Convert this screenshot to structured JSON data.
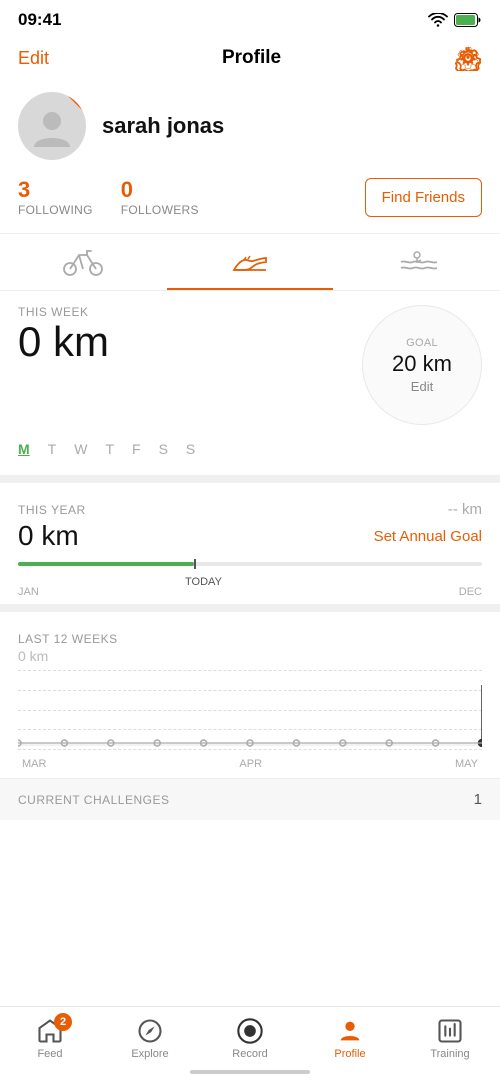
{
  "statusBar": {
    "time": "09:41",
    "showArrow": true
  },
  "navBar": {
    "editLabel": "Edit",
    "title": "Profile"
  },
  "profile": {
    "name": "sarah jonas"
  },
  "stats": {
    "following": "3",
    "followingLabel": "FOLLOWING",
    "followers": "0",
    "followersLabel": "FOLLOWERS",
    "findFriendsLabel": "Find Friends"
  },
  "tabs": [
    {
      "icon": "bike",
      "active": false
    },
    {
      "icon": "shoe",
      "active": true
    },
    {
      "icon": "swim",
      "active": false
    }
  ],
  "thisWeek": {
    "label": "THIS WEEK",
    "value": "0 km",
    "goal": {
      "label": "GOAL",
      "value": "20 km",
      "editLabel": "Edit"
    }
  },
  "days": [
    "M",
    "T",
    "W",
    "T",
    "F",
    "S",
    "S"
  ],
  "activeDay": "M",
  "thisYear": {
    "label": "THIS YEAR",
    "kmRight": "-- km",
    "value": "0 km",
    "setGoalLabel": "Set Annual Goal",
    "progressMonthStart": "JAN",
    "progressMonthEnd": "DEC",
    "todayLabel": "TODAY"
  },
  "last12Weeks": {
    "label": "LAST 12 WEEKS",
    "subValue": "0 km",
    "xLabels": [
      "MAR",
      "APR",
      "MAY"
    ]
  },
  "currentChallenges": {
    "label": "CURRENT CHALLENGES",
    "count": "1"
  },
  "bottomNav": {
    "items": [
      {
        "id": "feed",
        "label": "Feed",
        "badge": "2",
        "active": false
      },
      {
        "id": "explore",
        "label": "Explore",
        "badge": null,
        "active": false
      },
      {
        "id": "record",
        "label": "Record",
        "badge": null,
        "active": false
      },
      {
        "id": "profile",
        "label": "Profile",
        "badge": null,
        "active": true
      },
      {
        "id": "training",
        "label": "Training",
        "badge": null,
        "active": false
      }
    ]
  }
}
